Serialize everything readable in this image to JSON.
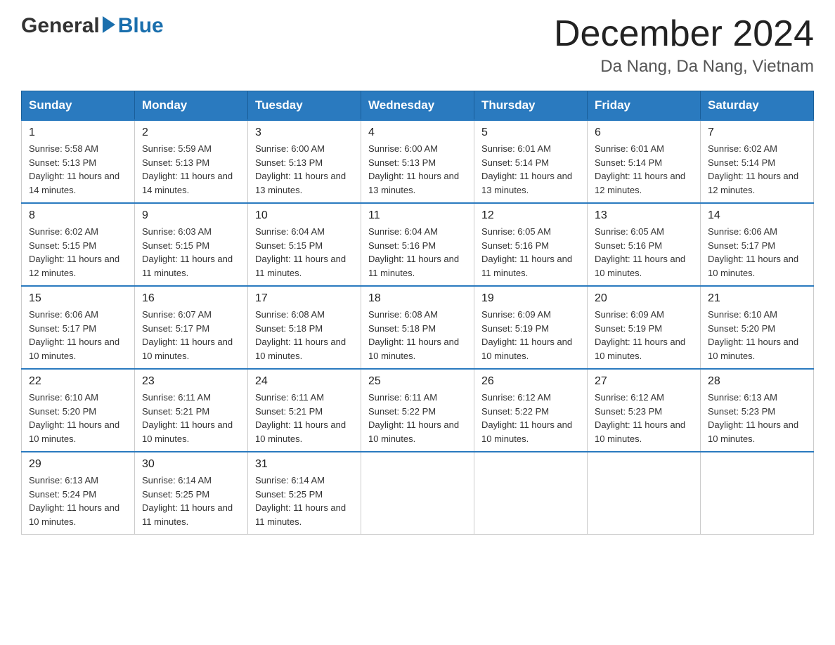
{
  "header": {
    "logo_general": "General",
    "logo_blue": "Blue",
    "month_title": "December 2024",
    "location": "Da Nang, Da Nang, Vietnam"
  },
  "weekdays": [
    "Sunday",
    "Monday",
    "Tuesday",
    "Wednesday",
    "Thursday",
    "Friday",
    "Saturday"
  ],
  "weeks": [
    [
      {
        "day": "1",
        "sunrise": "5:58 AM",
        "sunset": "5:13 PM",
        "daylight": "11 hours and 14 minutes."
      },
      {
        "day": "2",
        "sunrise": "5:59 AM",
        "sunset": "5:13 PM",
        "daylight": "11 hours and 14 minutes."
      },
      {
        "day": "3",
        "sunrise": "6:00 AM",
        "sunset": "5:13 PM",
        "daylight": "11 hours and 13 minutes."
      },
      {
        "day": "4",
        "sunrise": "6:00 AM",
        "sunset": "5:13 PM",
        "daylight": "11 hours and 13 minutes."
      },
      {
        "day": "5",
        "sunrise": "6:01 AM",
        "sunset": "5:14 PM",
        "daylight": "11 hours and 13 minutes."
      },
      {
        "day": "6",
        "sunrise": "6:01 AM",
        "sunset": "5:14 PM",
        "daylight": "11 hours and 12 minutes."
      },
      {
        "day": "7",
        "sunrise": "6:02 AM",
        "sunset": "5:14 PM",
        "daylight": "11 hours and 12 minutes."
      }
    ],
    [
      {
        "day": "8",
        "sunrise": "6:02 AM",
        "sunset": "5:15 PM",
        "daylight": "11 hours and 12 minutes."
      },
      {
        "day": "9",
        "sunrise": "6:03 AM",
        "sunset": "5:15 PM",
        "daylight": "11 hours and 11 minutes."
      },
      {
        "day": "10",
        "sunrise": "6:04 AM",
        "sunset": "5:15 PM",
        "daylight": "11 hours and 11 minutes."
      },
      {
        "day": "11",
        "sunrise": "6:04 AM",
        "sunset": "5:16 PM",
        "daylight": "11 hours and 11 minutes."
      },
      {
        "day": "12",
        "sunrise": "6:05 AM",
        "sunset": "5:16 PM",
        "daylight": "11 hours and 11 minutes."
      },
      {
        "day": "13",
        "sunrise": "6:05 AM",
        "sunset": "5:16 PM",
        "daylight": "11 hours and 10 minutes."
      },
      {
        "day": "14",
        "sunrise": "6:06 AM",
        "sunset": "5:17 PM",
        "daylight": "11 hours and 10 minutes."
      }
    ],
    [
      {
        "day": "15",
        "sunrise": "6:06 AM",
        "sunset": "5:17 PM",
        "daylight": "11 hours and 10 minutes."
      },
      {
        "day": "16",
        "sunrise": "6:07 AM",
        "sunset": "5:17 PM",
        "daylight": "11 hours and 10 minutes."
      },
      {
        "day": "17",
        "sunrise": "6:08 AM",
        "sunset": "5:18 PM",
        "daylight": "11 hours and 10 minutes."
      },
      {
        "day": "18",
        "sunrise": "6:08 AM",
        "sunset": "5:18 PM",
        "daylight": "11 hours and 10 minutes."
      },
      {
        "day": "19",
        "sunrise": "6:09 AM",
        "sunset": "5:19 PM",
        "daylight": "11 hours and 10 minutes."
      },
      {
        "day": "20",
        "sunrise": "6:09 AM",
        "sunset": "5:19 PM",
        "daylight": "11 hours and 10 minutes."
      },
      {
        "day": "21",
        "sunrise": "6:10 AM",
        "sunset": "5:20 PM",
        "daylight": "11 hours and 10 minutes."
      }
    ],
    [
      {
        "day": "22",
        "sunrise": "6:10 AM",
        "sunset": "5:20 PM",
        "daylight": "11 hours and 10 minutes."
      },
      {
        "day": "23",
        "sunrise": "6:11 AM",
        "sunset": "5:21 PM",
        "daylight": "11 hours and 10 minutes."
      },
      {
        "day": "24",
        "sunrise": "6:11 AM",
        "sunset": "5:21 PM",
        "daylight": "11 hours and 10 minutes."
      },
      {
        "day": "25",
        "sunrise": "6:11 AM",
        "sunset": "5:22 PM",
        "daylight": "11 hours and 10 minutes."
      },
      {
        "day": "26",
        "sunrise": "6:12 AM",
        "sunset": "5:22 PM",
        "daylight": "11 hours and 10 minutes."
      },
      {
        "day": "27",
        "sunrise": "6:12 AM",
        "sunset": "5:23 PM",
        "daylight": "11 hours and 10 minutes."
      },
      {
        "day": "28",
        "sunrise": "6:13 AM",
        "sunset": "5:23 PM",
        "daylight": "11 hours and 10 minutes."
      }
    ],
    [
      {
        "day": "29",
        "sunrise": "6:13 AM",
        "sunset": "5:24 PM",
        "daylight": "11 hours and 10 minutes."
      },
      {
        "day": "30",
        "sunrise": "6:14 AM",
        "sunset": "5:25 PM",
        "daylight": "11 hours and 11 minutes."
      },
      {
        "day": "31",
        "sunrise": "6:14 AM",
        "sunset": "5:25 PM",
        "daylight": "11 hours and 11 minutes."
      },
      null,
      null,
      null,
      null
    ]
  ],
  "labels": {
    "sunrise_prefix": "Sunrise: ",
    "sunset_prefix": "Sunset: ",
    "daylight_prefix": "Daylight: "
  }
}
